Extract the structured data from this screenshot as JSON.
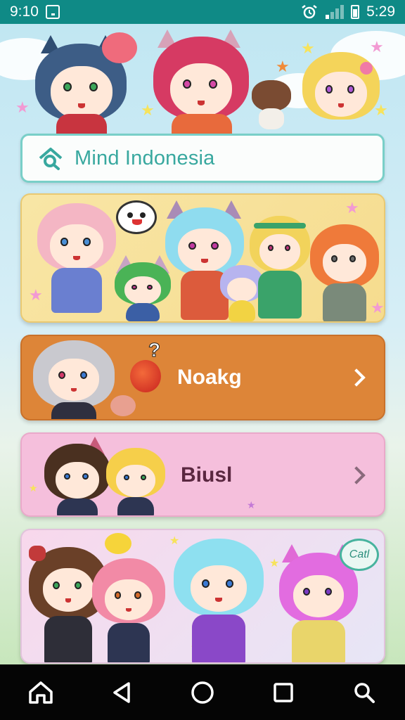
{
  "status_bar": {
    "time_left": "9:10",
    "time_right": "5:29",
    "icons": [
      "screenshot-icon",
      "alarm-icon",
      "signal-icon",
      "battery-icon"
    ]
  },
  "header": {
    "title": "Mind Indonesia",
    "logo_icon": "search-house-icon"
  },
  "panels": [
    {
      "id": "group-panel",
      "label": ""
    },
    {
      "id": "noakg-panel",
      "label": "Noakg",
      "icon": "apple-question-icon",
      "chevron": "chevron-right-icon"
    },
    {
      "id": "biusl-panel",
      "label": "Biusl",
      "chevron": "chevron-right-icon"
    },
    {
      "id": "cat-panel",
      "label": "",
      "bubble_text": "Catl"
    }
  ],
  "nav": {
    "items": [
      "home-icon",
      "back-icon",
      "circle-home-icon",
      "recents-icon",
      "search-icon"
    ]
  },
  "colors": {
    "status_bar": "#0f8a86",
    "title_accent": "#38a89f",
    "panel_orange": "#dd8538",
    "panel_pink": "#f5bfdc",
    "panel_yellow": "#f8e6a6"
  }
}
